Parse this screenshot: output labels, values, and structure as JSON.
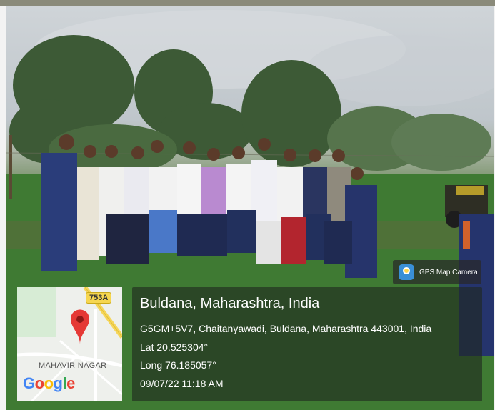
{
  "badge": {
    "icon": "gps-map-camera-icon",
    "label": "GPS Map Camera"
  },
  "map": {
    "road_number": "753A",
    "area_name": "MAHAVIR NAGAR",
    "brand": [
      "G",
      "o",
      "o",
      "g",
      "l",
      "e"
    ],
    "brand_colors": [
      "#4285F4",
      "#EA4335",
      "#FBBC05",
      "#4285F4",
      "#34A853",
      "#EA4335"
    ],
    "pin_color": "#e53935"
  },
  "location": {
    "place": "Buldana, Maharashtra, India",
    "address": "G5GM+5V7, Chaitanyawadi, Buldana, Maharashtra 443001, India",
    "lat": "Lat 20.525304°",
    "long": "Long 76.185057°",
    "datetime": "09/07/22 11:18 AM"
  }
}
